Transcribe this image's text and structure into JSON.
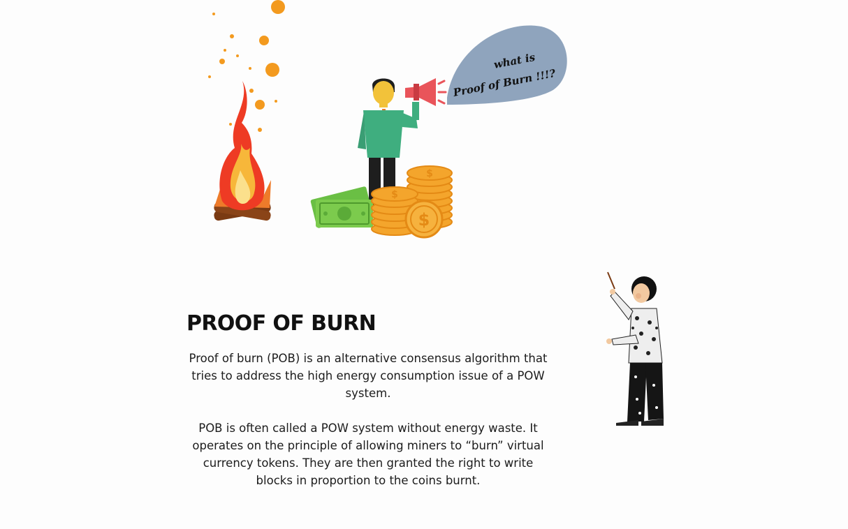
{
  "title": "PROOF OF BURN",
  "speech_bubble": {
    "line1": "what is",
    "line2": "Proof of Burn !!!?"
  },
  "paragraphs": [
    "Proof of burn (POB) is an alternative consensus algorithm that tries to address the high energy consumption issue of a POW system.",
    "POB is often called a POW system without energy waste. It operates on the principle of allowing miners to “burn” virtual currency tokens. They are then granted the right to write blocks in proportion to the coins burnt."
  ],
  "coin_symbol": "$",
  "colors": {
    "bubble": "#8fa4bd",
    "suit": "#3fae7f",
    "coin": "#f4a52c",
    "flame_outer": "#ef3b24",
    "flame_inner": "#fbe08c",
    "cash": "#7ccb4d",
    "megaphone": "#e9545a"
  },
  "icons": [
    "fire-icon",
    "megaphone-icon",
    "money-icon",
    "coin-stack-icon"
  ]
}
